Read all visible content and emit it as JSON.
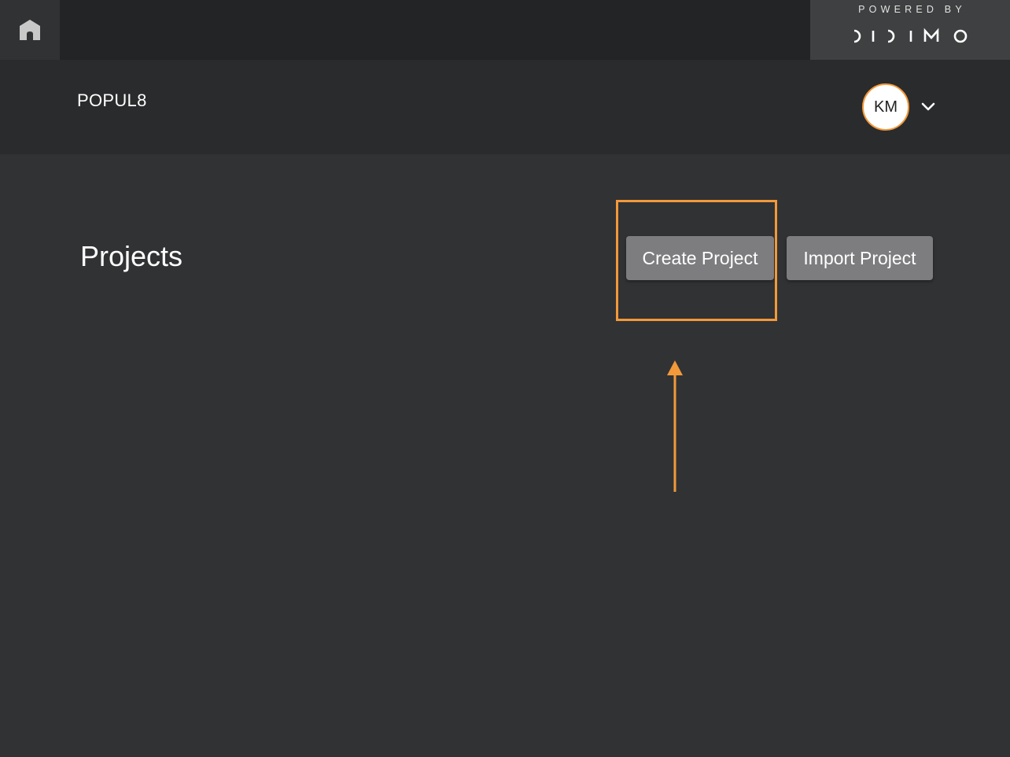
{
  "topbar": {
    "home_icon": "home-icon",
    "powered_by": "POWERED BY",
    "brand_logo_text": "DIDIMO"
  },
  "header": {
    "app_title": "POPUL8",
    "user": {
      "initials": "KM",
      "menu_icon": "chevron-down-icon"
    }
  },
  "main": {
    "title": "Projects",
    "actions": {
      "create_label": "Create Project",
      "import_label": "Import Project"
    }
  },
  "annotation": {
    "highlight_target": "create-project-button",
    "arrow_icon": "arrow-up-icon"
  },
  "colors": {
    "background": "#313234",
    "topbar": "#232425",
    "header": "#2a2b2c",
    "button": "#7d7d80",
    "accent": "#f2993a"
  }
}
